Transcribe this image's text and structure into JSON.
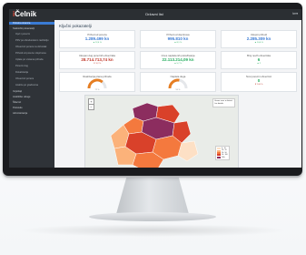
{
  "app": {
    "logo_prefix": "i",
    "logo_text": "Čelnik",
    "window_title": "Državni list",
    "user_label": "tm▾"
  },
  "sidebar": {
    "items": [
      {
        "label": "Početna stranica",
        "active": true
      },
      {
        "label": "Statistički pokazatelji",
        "active": false
      },
      {
        "label": "Opći i porezni",
        "sub": true
      },
      {
        "label": "PDV po obračunskom razdoblju",
        "sub": true
      },
      {
        "label": "Obveznici poreza na dohodak",
        "sub": true
      },
      {
        "label": "Prihodi od poreza i doprinosa",
        "sub": true
      },
      {
        "label": "Uplate po vrstama prihoda",
        "sub": true
      },
      {
        "label": "Porezni dug",
        "sub": true
      },
      {
        "label": "Fiskalizacija",
        "sub": true
      },
      {
        "label": "Obveznici poreza",
        "sub": true
      },
      {
        "label": "Analize po gradovima",
        "sub": true
      },
      {
        "label": "Izvještaji",
        "active": false
      },
      {
        "label": "Analitičke usluge",
        "active": false
      },
      {
        "label": "Šifarnici",
        "active": false
      },
      {
        "label": "Postavke",
        "active": false
      },
      {
        "label": "Administracija",
        "active": false
      }
    ]
  },
  "main": {
    "title": "Ključni pokazatelji",
    "cards_row1": [
      {
        "label": "Prihod od poreza",
        "value": "1.289.499 kn",
        "sub": "▲ 12,4 %",
        "trend": "up",
        "color": "#3a7bd5"
      },
      {
        "label": "Prihod od doprinosa",
        "value": "995.810 kn",
        "sub": "▲ 8,1 %",
        "trend": "up",
        "color": "#3a7bd5"
      },
      {
        "label": "Ukupni prihodi",
        "value": "2.285.309 kn",
        "sub": "▲ 10,6 %",
        "trend": "up",
        "color": "#3a7bd5"
      }
    ],
    "cards_row2": [
      {
        "label": "Ukupan dug poreznih obveznika",
        "value": "28.714.713,74 kn",
        "sub": "▼ 3,2 %",
        "trend": "down",
        "color": "#c0392b"
      },
      {
        "label": "Iznos naplaćenih potraživanja",
        "value": "22.113.214,09 kn",
        "sub": "▲ 5,7 %",
        "trend": "up",
        "color": "#27ae60"
      },
      {
        "label": "Broj novih obveznika",
        "value": "6",
        "sub": "▲ 2",
        "trend": "up",
        "color": "#27ae60"
      }
    ],
    "cards_row3": [
      {
        "label": "Realizacija plana prihoda",
        "gauge": 0.72,
        "sub": "72 %"
      },
      {
        "label": "Naplata duga",
        "gauge": 0.55,
        "sub": "55 %"
      },
      {
        "label": "Novi porezni obveznici",
        "value": "0",
        "sub": "▼ 100 %",
        "trend": "down",
        "color": "#27ae60"
      }
    ],
    "map": {
      "zoom_in": "+",
      "zoom_out": "−",
      "tooltip_line1": "Hover over a district",
      "tooltip_line2": "for details",
      "legend": [
        {
          "label": "0 - 10",
          "color": "#fde0c5"
        },
        {
          "label": "10 - 20",
          "color": "#fbb27a"
        },
        {
          "label": "20 - 50",
          "color": "#f4793e"
        },
        {
          "label": "50 - 100",
          "color": "#d9412a"
        },
        {
          "label": "100+",
          "color": "#8c2d5f"
        }
      ]
    }
  }
}
